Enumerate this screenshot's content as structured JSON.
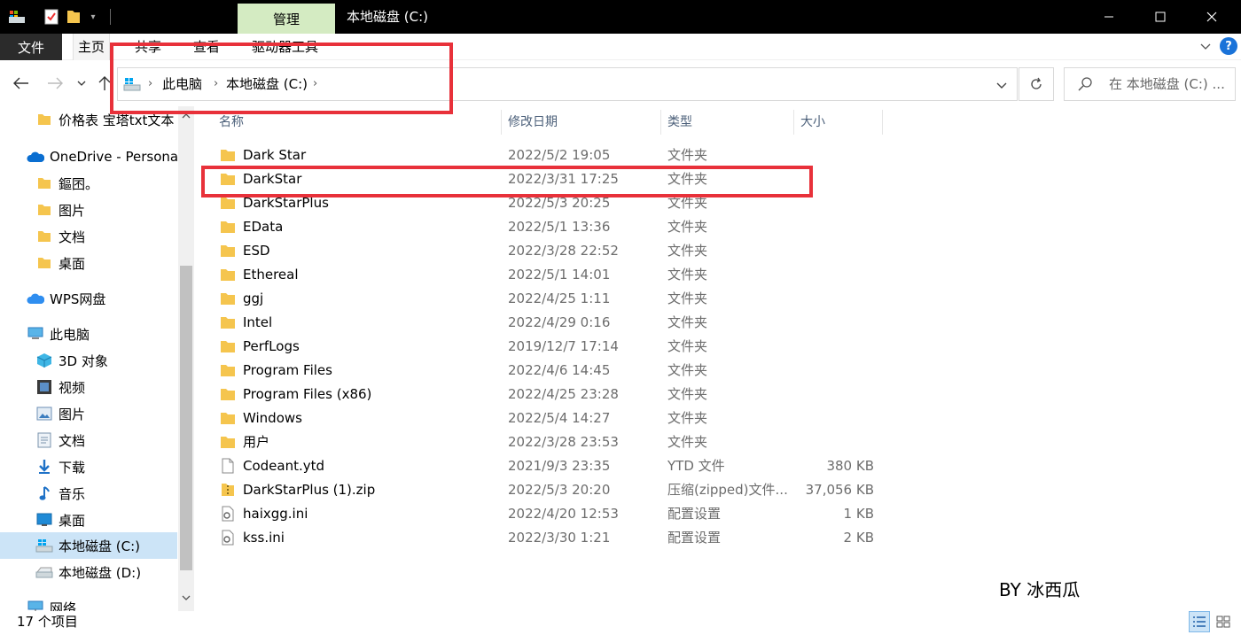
{
  "titlebar": {
    "manage_tab": "管理",
    "title": "本地磁盘 (C:)",
    "quick_access_icons": [
      "drive-icon",
      "properties-icon",
      "new-folder-icon",
      "customize-chevron-icon"
    ]
  },
  "ribbon": {
    "tabs": [
      "文件",
      "主页",
      "共享",
      "查看",
      "驱动器工具"
    ],
    "help_label": "?"
  },
  "address": {
    "crumbs": [
      "此电脑",
      "本地磁盘 (C:)"
    ]
  },
  "search": {
    "placeholder": "在 本地磁盘 (C:) ..."
  },
  "nav": {
    "items": [
      {
        "label": "价格表 宝塔txt文本",
        "icon": "folder-icon"
      },
      {
        "label": "OneDrive - Personal",
        "icon": "onedrive-icon"
      },
      {
        "label": "鏂囨。",
        "icon": "folder-icon"
      },
      {
        "label": "图片",
        "icon": "folder-icon"
      },
      {
        "label": "文档",
        "icon": "folder-icon"
      },
      {
        "label": "桌面",
        "icon": "folder-icon"
      },
      {
        "label": "WPS网盘",
        "icon": "wps-cloud-icon"
      },
      {
        "label": "此电脑",
        "icon": "this-pc-icon"
      },
      {
        "label": "3D 对象",
        "icon": "3d-objects-icon"
      },
      {
        "label": "视频",
        "icon": "videos-icon"
      },
      {
        "label": "图片",
        "icon": "pictures-icon"
      },
      {
        "label": "文档",
        "icon": "documents-icon"
      },
      {
        "label": "下载",
        "icon": "downloads-icon"
      },
      {
        "label": "音乐",
        "icon": "music-icon"
      },
      {
        "label": "桌面",
        "icon": "desktop-icon"
      },
      {
        "label": "本地磁盘 (C:)",
        "icon": "windows-drive-icon"
      },
      {
        "label": "本地磁盘 (D:)",
        "icon": "drive-icon"
      },
      {
        "label": "网络",
        "icon": "network-icon"
      }
    ]
  },
  "columns": {
    "name": "名称",
    "date": "修改日期",
    "type": "类型",
    "size": "大小"
  },
  "files": [
    {
      "name": "Dark Star",
      "date": "2022/5/2 19:05",
      "type": "文件夹",
      "size": "",
      "icon": "folder-icon"
    },
    {
      "name": "DarkStar",
      "date": "2022/3/31 17:25",
      "type": "文件夹",
      "size": "",
      "icon": "folder-icon"
    },
    {
      "name": "DarkStarPlus",
      "date": "2022/5/3 20:25",
      "type": "文件夹",
      "size": "",
      "icon": "folder-icon"
    },
    {
      "name": "EData",
      "date": "2022/5/1 13:36",
      "type": "文件夹",
      "size": "",
      "icon": "folder-icon"
    },
    {
      "name": "ESD",
      "date": "2022/3/28 22:52",
      "type": "文件夹",
      "size": "",
      "icon": "folder-icon"
    },
    {
      "name": "Ethereal",
      "date": "2022/5/1 14:01",
      "type": "文件夹",
      "size": "",
      "icon": "folder-icon"
    },
    {
      "name": "ggj",
      "date": "2022/4/25 1:11",
      "type": "文件夹",
      "size": "",
      "icon": "folder-icon"
    },
    {
      "name": "Intel",
      "date": "2022/4/29 0:16",
      "type": "文件夹",
      "size": "",
      "icon": "folder-icon"
    },
    {
      "name": "PerfLogs",
      "date": "2019/12/7 17:14",
      "type": "文件夹",
      "size": "",
      "icon": "folder-icon"
    },
    {
      "name": "Program Files",
      "date": "2022/4/6 14:45",
      "type": "文件夹",
      "size": "",
      "icon": "folder-icon"
    },
    {
      "name": "Program Files (x86)",
      "date": "2022/4/25 23:28",
      "type": "文件夹",
      "size": "",
      "icon": "folder-icon"
    },
    {
      "name": "Windows",
      "date": "2022/5/4 14:27",
      "type": "文件夹",
      "size": "",
      "icon": "folder-icon"
    },
    {
      "name": "用户",
      "date": "2022/3/28 23:53",
      "type": "文件夹",
      "size": "",
      "icon": "folder-icon"
    },
    {
      "name": "Codeant.ytd",
      "date": "2021/9/3 23:35",
      "type": "YTD 文件",
      "size": "380 KB",
      "icon": "file-icon"
    },
    {
      "name": "DarkStarPlus (1).zip",
      "date": "2022/5/3 20:20",
      "type": "压缩(zipped)文件...",
      "size": "37,056 KB",
      "icon": "zip-icon"
    },
    {
      "name": "haixgg.ini",
      "date": "2022/4/20 12:53",
      "type": "配置设置",
      "size": "1 KB",
      "icon": "ini-icon"
    },
    {
      "name": "kss.ini",
      "date": "2022/3/30 1:21",
      "type": "配置设置",
      "size": "2 KB",
      "icon": "ini-icon"
    }
  ],
  "watermark": "BY 冰西瓜",
  "status": {
    "count": "17 个项目"
  },
  "colors": {
    "highlight": "#e8313a",
    "manage_tab_bg": "#d4ebc2",
    "selection": "#cce4f7",
    "folder": "#f5c54e"
  }
}
